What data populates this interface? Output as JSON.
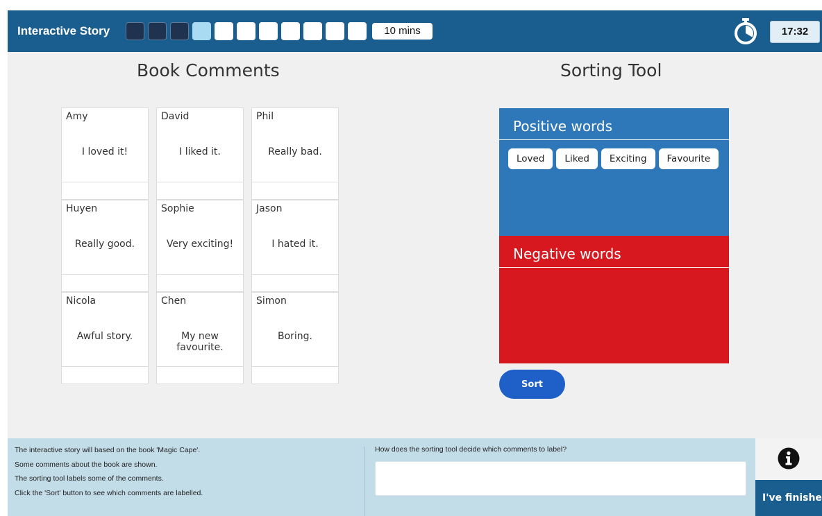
{
  "header": {
    "title": "Interactive Story",
    "progress": {
      "total_steps": 11,
      "completed_steps": 3,
      "current_step": 4
    },
    "time_limit": "10 mins",
    "timer_icon": "stopwatch-icon",
    "clock": "17:32"
  },
  "book_comments": {
    "title": "Book Comments",
    "cards": [
      {
        "name": "Amy",
        "comment": "I loved it!"
      },
      {
        "name": "David",
        "comment": "I liked it."
      },
      {
        "name": "Phil",
        "comment": "Really bad."
      },
      {
        "name": "Huyen",
        "comment": "Really good."
      },
      {
        "name": "Sophie",
        "comment": "Very exciting!"
      },
      {
        "name": "Jason",
        "comment": "I hated it."
      },
      {
        "name": "Nicola",
        "comment": "Awful story."
      },
      {
        "name": "Chen",
        "comment": "My new favourite."
      },
      {
        "name": "Simon",
        "comment": "Boring."
      }
    ]
  },
  "sorting_tool": {
    "title": "Sorting Tool",
    "positive": {
      "label": "Positive words",
      "words": [
        "Loved",
        "Liked",
        "Exciting",
        "Favourite"
      ],
      "color": "#2e78ba"
    },
    "negative": {
      "label": "Negative words",
      "words": [],
      "color": "#d7181f"
    },
    "sort_button": "Sort"
  },
  "footer": {
    "instructions": [
      "The interactive story will based on the book 'Magic Cape'.",
      "Some comments about the book are shown.",
      "The sorting tool labels some of the comments.",
      "Click the 'Sort' button to see which comments are labelled."
    ],
    "question": "How does the sorting tool decide which comments to label?",
    "answer_value": "",
    "info_icon": "info-icon",
    "finished_button": "I've finished"
  },
  "colors": {
    "topbar": "#1a5e8f",
    "bottombar": "#c3dde8",
    "progress_done": "#1f3350",
    "progress_current": "#a9dcf3",
    "sort_button": "#1f5fc8"
  }
}
